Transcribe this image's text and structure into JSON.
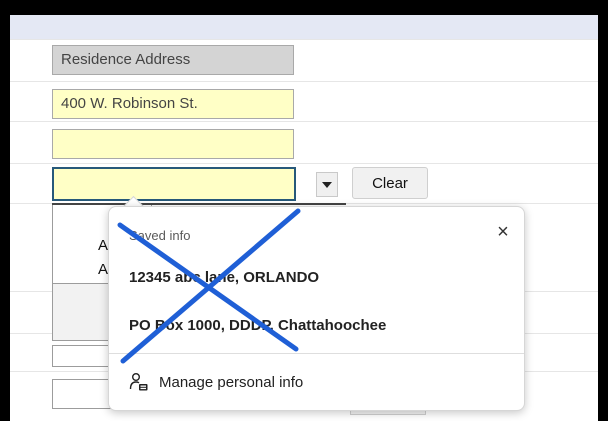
{
  "form": {
    "residence_label": "Residence Address",
    "address_value": "400 W. Robinson St.",
    "address_line2_value": "",
    "autofill_field_value": "",
    "clear_label": "Clear",
    "underlay_letter_1": "A",
    "underlay_letter_2": "A"
  },
  "autofill_popup": {
    "title": "Saved info",
    "suggestions": [
      {
        "label": "12345 abc lane, ORLANDO"
      },
      {
        "label": "PO Box 1000, DDDP, Chattahoochee"
      }
    ],
    "manage_label": "Manage personal info",
    "close_icon": "close-icon",
    "manage_icon": "manage-personal-info-icon"
  },
  "annotation": {
    "strike_color": "#1f5fd6"
  }
}
